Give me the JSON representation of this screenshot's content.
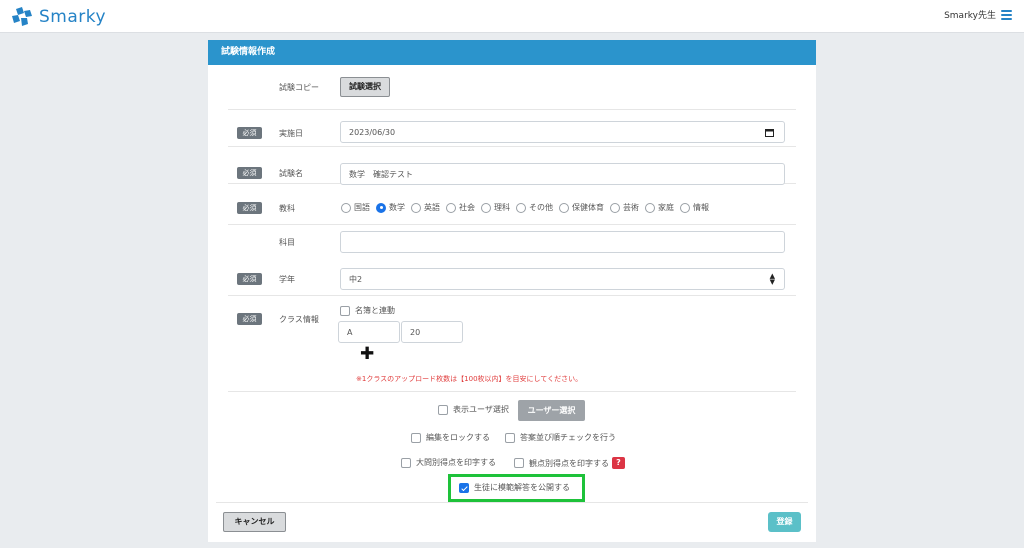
{
  "app": {
    "name": "Smarky",
    "brand_color": "#2583c6"
  },
  "header": {
    "user_label": "Smarky先生",
    "menu_icon": "hamburger-icon"
  },
  "panel": {
    "title": "試験情報作成",
    "header_color": "#2b94cc"
  },
  "form": {
    "required_badge": "必須",
    "copy": {
      "label": "試験コピー",
      "button": "試験選択"
    },
    "date": {
      "label": "実施日",
      "value": "2023/06/30"
    },
    "name": {
      "label": "試験名",
      "value": "数学　確認テスト"
    },
    "subject": {
      "label": "教科",
      "options": [
        "国語",
        "数学",
        "英語",
        "社会",
        "理科",
        "その他",
        "保健体育",
        "芸術",
        "家庭",
        "情報"
      ],
      "selected": "数学"
    },
    "course": {
      "label": "科目",
      "value": ""
    },
    "grade": {
      "label": "学年",
      "value": "中2"
    },
    "class_info": {
      "label": "クラス情報",
      "link_checkbox": "名簿と連動",
      "class_value": "A",
      "count_value": "20",
      "note": "※1クラスのアップロード枚数は【100枚以内】を目安にしてください。"
    },
    "options": {
      "show_user_select": "表示ユーザ選択",
      "user_select_button": "ユーザー選択",
      "lock_edit": "編集をロックする",
      "answer_check": "答案並び順チェックを行う",
      "print_question_score": "大問別得点を印字する",
      "print_view_score": "観点別得点を印字する",
      "help": "?",
      "publish_answer": "生徒に模範解答を公開する"
    },
    "cancel_button": "キャンセル",
    "submit_button": "登録"
  }
}
